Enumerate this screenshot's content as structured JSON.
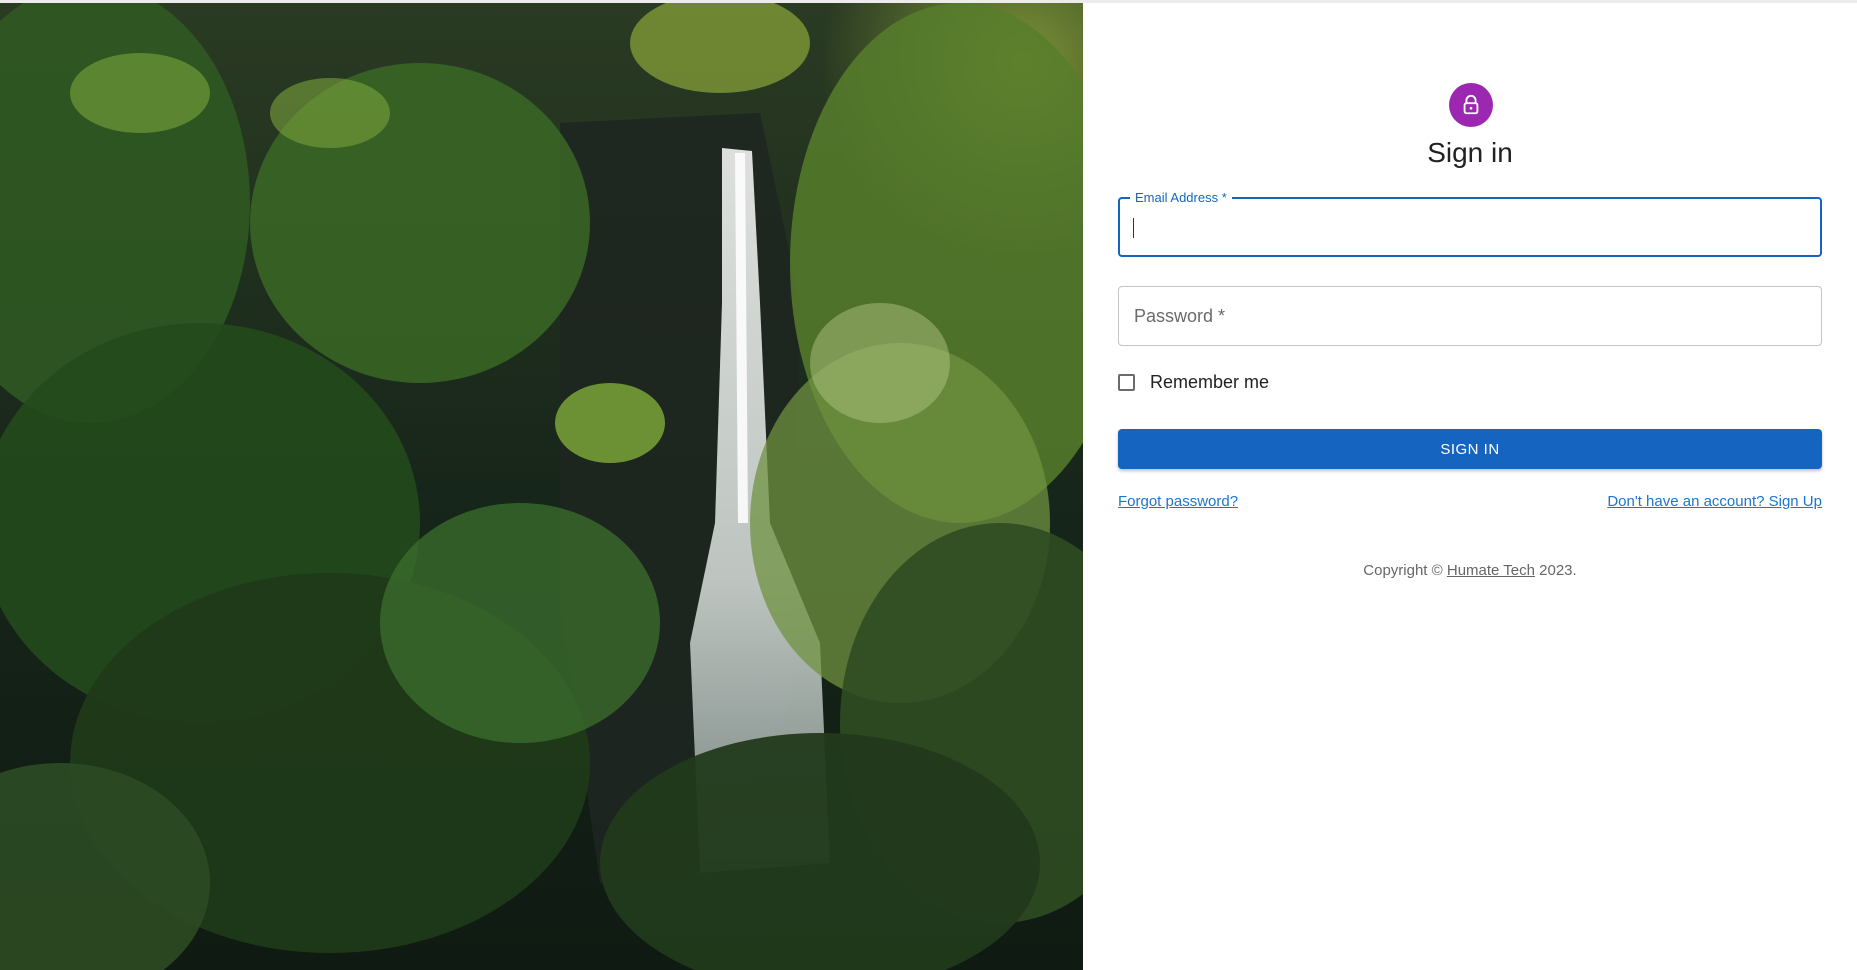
{
  "hero": {
    "image": "forest-waterfall-photo"
  },
  "auth": {
    "icon": "lock-icon",
    "title": "Sign in",
    "email": {
      "label": "Email Address",
      "required_mark": "*",
      "value": ""
    },
    "password": {
      "label": "Password",
      "required_mark": "*",
      "value": ""
    },
    "remember_me": {
      "label": "Remember me",
      "checked": false
    },
    "submit_label": "SIGN IN",
    "forgot_password_link": "Forgot password?",
    "signup_link": "Don't have an account? Sign Up"
  },
  "footer": {
    "copyright_prefix": "Copyright ©",
    "company": "Humate Tech",
    "year_suffix": "2023."
  },
  "colors": {
    "primary": "#1565c0",
    "avatar": "#9c27b0",
    "link": "#1976d2"
  }
}
